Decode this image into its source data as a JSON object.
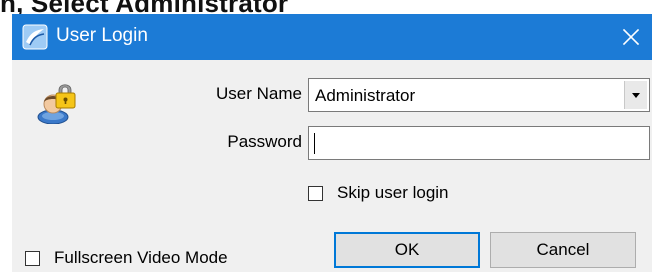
{
  "caption": {
    "text": "n, Select Administrator"
  },
  "window": {
    "title": "User Login",
    "accent_color": "#1c7bd6",
    "icons": {
      "app": "app-logo-icon",
      "close": "close-icon",
      "user": "user-lock-icon",
      "dropdown": "chevron-down-icon"
    }
  },
  "form": {
    "username_label": "User Name",
    "username_value": "Administrator",
    "password_label": "Password",
    "password_value": "",
    "skip_login_label": "Skip user login",
    "skip_login_checked": false,
    "fullscreen_label": "Fullscreen Video Mode",
    "fullscreen_checked": false
  },
  "buttons": {
    "ok_label": "OK",
    "cancel_label": "Cancel",
    "close_glyph": "✕"
  }
}
